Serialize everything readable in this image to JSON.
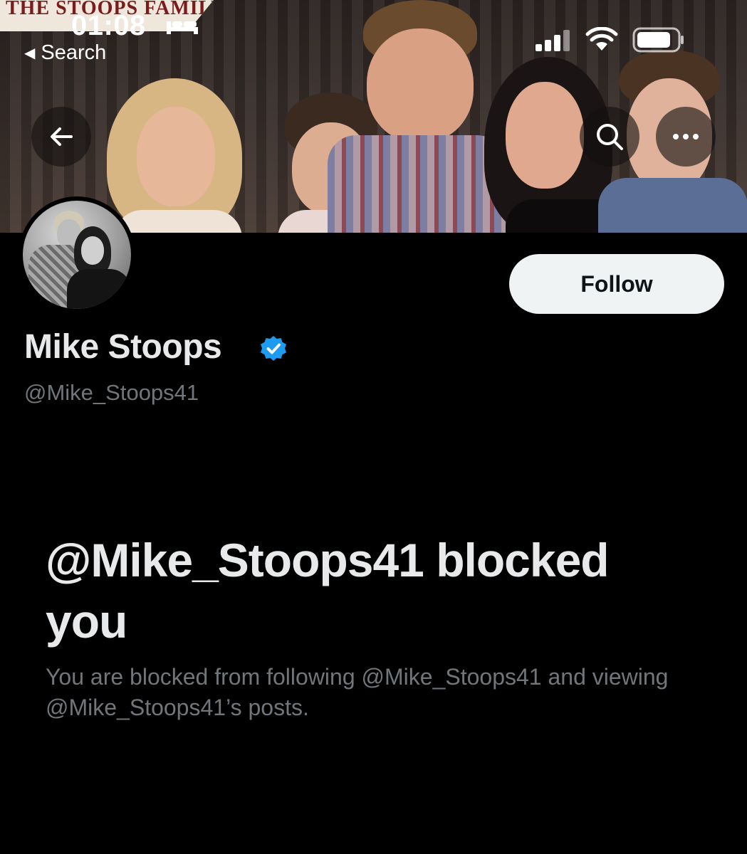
{
  "status_bar": {
    "time": "01:08",
    "back_label": "Search"
  },
  "banner": {
    "sign_text": "THE STOOPS FAMILY"
  },
  "profile": {
    "display_name": "Mike Stoops",
    "handle": "@Mike_Stoops41",
    "follow_label": "Follow",
    "verified": true
  },
  "blocked": {
    "title": "@Mike_Stoops41 blocked you",
    "description": "You are blocked from following @Mike_Stoops41 and viewing @Mike_Stoops41’s posts."
  },
  "colors": {
    "background": "#000000",
    "primary_text": "#e7e9ea",
    "secondary_text": "#71767b",
    "follow_button_bg": "#eff3f4",
    "verified_blue": "#1d9bf0"
  }
}
